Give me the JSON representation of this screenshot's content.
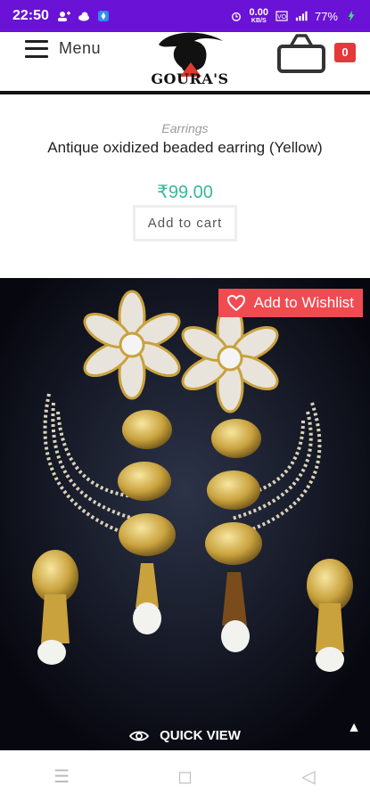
{
  "status_bar": {
    "time": "22:50",
    "data_speed": "0.00",
    "data_unit": "KB/S",
    "battery": "77%"
  },
  "header": {
    "menu_label": "Menu",
    "logo_text": "GOURA'S",
    "cart_count": "0"
  },
  "product": {
    "category": "Earrings",
    "title": "Antique oxidized beaded earring (Yellow)",
    "price": "₹99.00",
    "add_to_cart_label": "Add to cart",
    "wishlist_label": "Add to Wishlist",
    "quick_view_label": "QUICK VIEW"
  },
  "colors": {
    "status_bar": "#6a12d6",
    "price": "#36b9a0",
    "wishlist": "#f14b52",
    "cart_badge": "#e5383b"
  },
  "system_nav": {
    "icons": [
      "menu-icon",
      "home-square-icon",
      "back-triangle-icon"
    ]
  }
}
